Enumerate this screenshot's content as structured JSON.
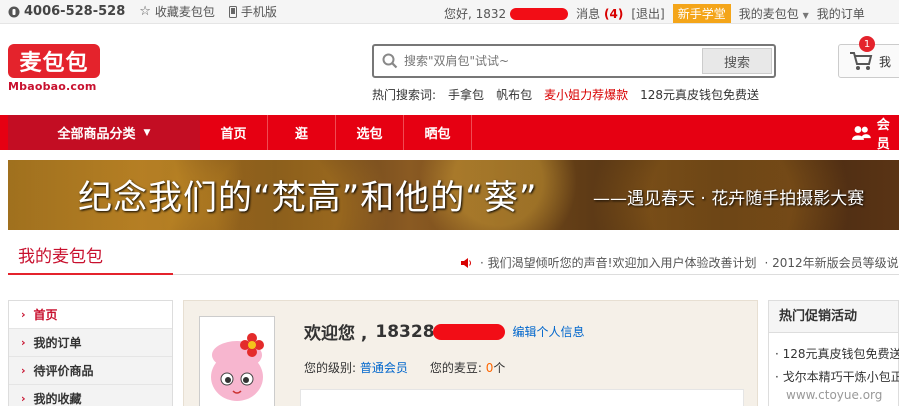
{
  "topbar": {
    "phone": "4006-528-528",
    "favorite": "收藏麦包包",
    "mobile": "手机版",
    "greeting": "您好, 1832",
    "messages": "消息",
    "message_count": "(4)",
    "logout": "[退出]",
    "newbie": "新手学堂",
    "my_mbaobao": "我的麦包包",
    "my_orders": "我的订单"
  },
  "header": {
    "logo_text": "麦包包",
    "logo_sub": "Mbaobao.com",
    "search_placeholder": "搜索\"双肩包\"试试~",
    "search_button": "搜索",
    "hot_label": "热门搜索词:",
    "hot_terms": [
      "手拿包",
      "帆布包",
      "麦小姐力荐爆款",
      "128元真皮钱包免费送"
    ],
    "cart_count": "1",
    "cart_label": "我"
  },
  "nav": {
    "all_categories": "全部商品分类",
    "items": [
      "首页",
      "逛",
      "选包",
      "晒包"
    ],
    "member": "会员"
  },
  "banner": {
    "main_text": "纪念我们的“梵高”和他的“葵”",
    "sub_text": "——遇见春天 · 花卉随手拍摄影大赛"
  },
  "section": {
    "title": "我的麦包包",
    "notices": [
      "· 我们渴望倾听您的声音!欢迎加入用户体验改善计划",
      "· 2012年新版会员等级说"
    ]
  },
  "sidebar": {
    "items": [
      "首页",
      "我的订单",
      "待评价商品",
      "我的收藏"
    ]
  },
  "welcome": {
    "title": "欢迎您 ,",
    "username": "18328",
    "edit": "编辑个人信息",
    "level_label": "您的级别:",
    "level_value": "普通会员",
    "beans_label": "您的麦豆:",
    "beans_value": "0",
    "beans_unit": "个"
  },
  "promo": {
    "title": "热门促销活动",
    "items": [
      "· 128元真皮钱包免费送",
      "· 戈尔本精巧干炼小包正"
    ]
  },
  "watermark": "www.ctoyue.org",
  "colors": {
    "brand_red": "#e60012",
    "dark_red": "#c30d23",
    "link_blue": "#0066cc",
    "orange": "#ff6600"
  }
}
